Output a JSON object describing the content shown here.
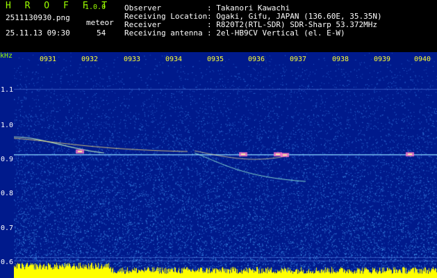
{
  "header": {
    "brand": "H R O F F T",
    "version": "1.0.0",
    "filename": "2511130930.png",
    "datetime": "25.11.13 09:30",
    "meteor_label": "meteor",
    "meteor_count": "54",
    "info": [
      {
        "key": "Observer",
        "value": ": Takanori Kawachi"
      },
      {
        "key": "Receiving Location",
        "value": ": Ogaki, Gifu, JAPAN (136.60E, 35.35N)"
      },
      {
        "key": "Receiver",
        "value": ": R820T2(RTL-SDR) SDR-Sharp 53.372MHz"
      },
      {
        "key": "Receiving antenna",
        "value": ": 2el-HB9CV Vertical (el. E-W)"
      }
    ]
  },
  "axis": {
    "unit": "kHz",
    "y_ticks": [
      "1.1",
      "1.0",
      "0.9",
      "0.8",
      "0.7",
      "0.6"
    ],
    "x_ticks": [
      "0931",
      "0932",
      "0933",
      "0934",
      "0935",
      "0936",
      "0937",
      "0938",
      "0939",
      "0940"
    ]
  },
  "colors": {
    "background": "#001a8c",
    "noise": "#2a6cff",
    "header_green": "#9cff00",
    "tick_yellow": "#ffff33",
    "baseline_yellow": "#ffff00"
  }
}
